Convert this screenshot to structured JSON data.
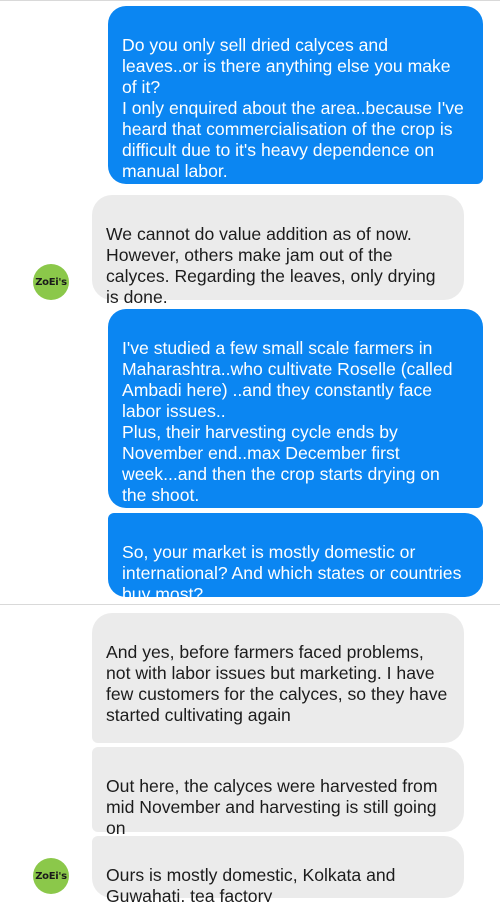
{
  "messages": [
    {
      "id": "m1",
      "direction": "outgoing",
      "text": "Do you only sell dried calyces and leaves..or is there anything else you make of it?\nI only enquired about the area..because I've heard that commercialisation of the crop is difficult due to it's heavy dependence on manual labor."
    },
    {
      "id": "m2",
      "direction": "incoming",
      "text": "We cannot do value addition as of now. However, others make jam out of the calyces. Regarding the leaves, only drying is done."
    },
    {
      "id": "m3",
      "direction": "outgoing",
      "text": "I've studied a few small scale farmers in Maharashtra..who cultivate Roselle (called Ambadi here) ..and they constantly face labor issues..\nPlus, their harvesting cycle ends by November end..max December first week...and then the crop starts drying on the shoot."
    },
    {
      "id": "m4",
      "direction": "outgoing",
      "text": "So, your market is mostly domestic or international? And which states or countries buy most?"
    },
    {
      "id": "m5",
      "direction": "incoming",
      "text": "And yes, before farmers faced problems, not with labor issues but marketing. I have few customers for the calyces, so they have started cultivating again"
    },
    {
      "id": "m6",
      "direction": "incoming",
      "text": "Out here, the calyces were harvested from mid November and harvesting is still going on"
    },
    {
      "id": "m7",
      "direction": "incoming",
      "text": "Ours is mostly domestic, Kolkata and Guwahati, tea factory"
    }
  ],
  "contact": {
    "avatar_text": "ZoEi's",
    "avatar_color": "#8bc84a"
  },
  "colors": {
    "outgoing_bubble": "#0b86f2",
    "incoming_bubble": "#ebebeb"
  }
}
